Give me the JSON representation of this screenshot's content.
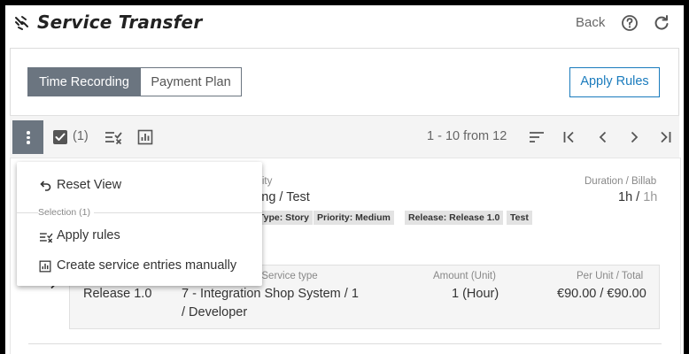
{
  "header": {
    "title": "Service Transfer",
    "back_label": "Back",
    "icons": [
      "service-logo-icon",
      "help-icon",
      "refresh-icon"
    ]
  },
  "mode_toggle": {
    "options": [
      "Time Recording",
      "Payment Plan"
    ],
    "selected": "Time Recording"
  },
  "apply_rules_label": "Apply Rules",
  "grid_toolbar": {
    "selection_count": "(1)",
    "pager_text": "1 - 10 from 12",
    "icons": [
      "more-vert-icon",
      "checkbox-checked-icon",
      "rule-icon",
      "chart-icon",
      "sort-icon",
      "first-page-icon",
      "prev-page-icon",
      "next-page-icon",
      "last-page-icon"
    ]
  },
  "row": {
    "activity_label": "rity",
    "activity_value": "ting / Test",
    "duration_label": "Duration / Billab",
    "duration_value": "1h",
    "duration_sep": " / ",
    "duration_billable": "1h",
    "tags": [
      "Type: Story",
      "Priority: Medium",
      "Release: Release 1.0",
      "Test"
    ],
    "entry": {
      "release": "Release 1.0",
      "service_label": "/ Service type",
      "service_line1": "7 - Integration Shop System / 1",
      "service_line2": "/ Developer",
      "amount_label": "Amount (Unit)",
      "amount_value": "1 (Hour)",
      "total_label": "Per Unit / Total",
      "total_value": "€90.00 / €90.00"
    }
  },
  "dropdown_menu": {
    "reset_view": "Reset View",
    "section_label": "Selection (1)",
    "apply_rules": "Apply rules",
    "create_entries": "Create service entries manually"
  },
  "colors": {
    "accent": "#1a7bbd",
    "active_segment": "#6b7580",
    "tag_bg": "#e3e3e3"
  }
}
